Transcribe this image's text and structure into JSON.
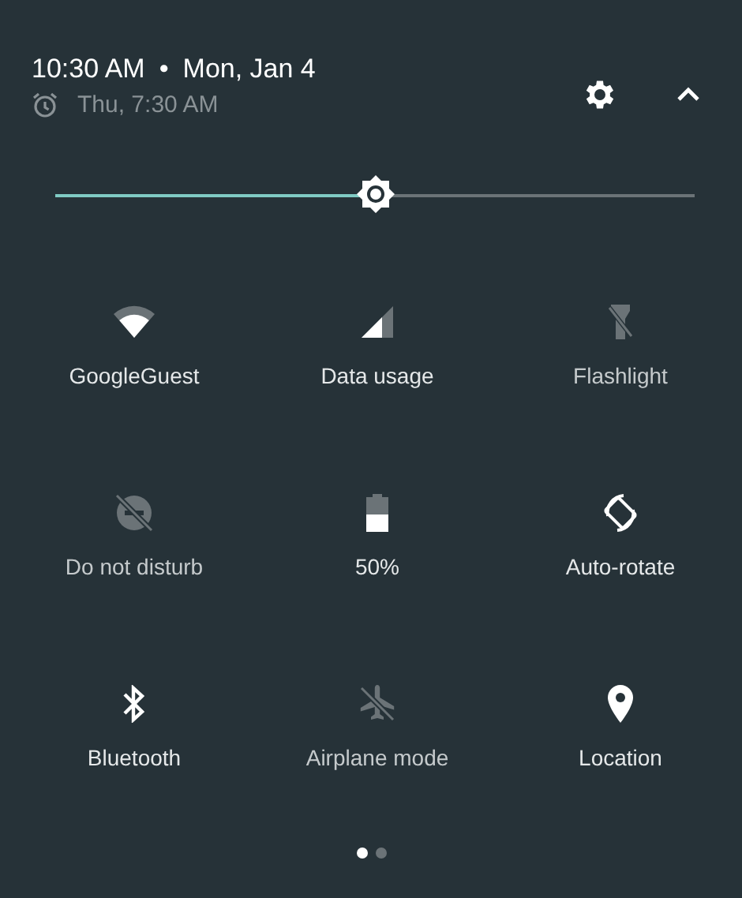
{
  "header": {
    "time": "10:30 AM",
    "separator": "•",
    "date": "Mon, Jan 4",
    "alarm": "Thu, 7:30 AM"
  },
  "brightness": {
    "level": 0.5
  },
  "tiles": [
    {
      "kind": "wifi",
      "label": "GoogleGuest",
      "on": true
    },
    {
      "kind": "data",
      "label": "Data usage",
      "on": true
    },
    {
      "kind": "flashlight",
      "label": "Flashlight",
      "on": false
    },
    {
      "kind": "dnd",
      "label": "Do not disturb",
      "on": false
    },
    {
      "kind": "battery",
      "label": "50%",
      "on": true
    },
    {
      "kind": "rotate",
      "label": "Auto-rotate",
      "on": true
    },
    {
      "kind": "bluetooth",
      "label": "Bluetooth",
      "on": true
    },
    {
      "kind": "airplane",
      "label": "Airplane mode",
      "on": false
    },
    {
      "kind": "location",
      "label": "Location",
      "on": true
    }
  ],
  "pages": [
    {
      "selected": true
    },
    {
      "selected": false
    }
  ]
}
